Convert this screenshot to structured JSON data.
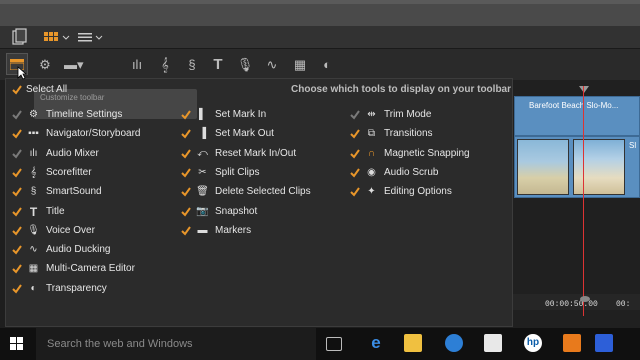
{
  "panel": {
    "select_all": "Select All",
    "header": "Choose which tools to display on your toolbar",
    "ghost_line1": "Customize toolbar",
    "col1": [
      {
        "label": "Timeline Settings",
        "icon": "gear-icon",
        "checked": "dim"
      },
      {
        "label": "Navigator/Storyboard",
        "icon": "navigator-icon",
        "checked": "on"
      },
      {
        "label": "Audio Mixer",
        "icon": "audio-mixer-icon",
        "checked": "dim"
      },
      {
        "label": "Scorefitter",
        "icon": "scorefitter-icon",
        "checked": "on"
      },
      {
        "label": "SmartSound",
        "icon": "smartsound-icon",
        "checked": "on"
      },
      {
        "label": "Title",
        "icon": "title-icon",
        "checked": "on"
      },
      {
        "label": "Voice Over",
        "icon": "microphone-icon",
        "checked": "on"
      },
      {
        "label": "Audio Ducking",
        "icon": "audio-ducking-icon",
        "checked": "on"
      },
      {
        "label": "Multi-Camera Editor",
        "icon": "multicam-icon",
        "checked": "on"
      },
      {
        "label": "Transparency",
        "icon": "transparency-icon",
        "checked": "on"
      }
    ],
    "col2": [
      {
        "label": "Set Mark In",
        "icon": "mark-in-icon",
        "checked": "on"
      },
      {
        "label": "Set Mark Out",
        "icon": "mark-out-icon",
        "checked": "on"
      },
      {
        "label": "Reset Mark In/Out",
        "icon": "reset-mark-icon",
        "checked": "on"
      },
      {
        "label": "Split Clips",
        "icon": "split-clip-icon",
        "checked": "on"
      },
      {
        "label": "Delete Selected Clips",
        "icon": "trash-icon",
        "checked": "on"
      },
      {
        "label": "Snapshot",
        "icon": "camera-icon",
        "checked": "on"
      },
      {
        "label": "Markers",
        "icon": "marker-icon",
        "checked": "on"
      }
    ],
    "col3": [
      {
        "label": "Trim Mode",
        "icon": "trim-icon",
        "checked": "dim"
      },
      {
        "label": "Transitions",
        "icon": "transitions-icon",
        "checked": "on"
      },
      {
        "label": "Magnetic Snapping",
        "icon": "magnet-icon",
        "checked": "on"
      },
      {
        "label": "Audio Scrub",
        "icon": "audio-scrub-icon",
        "checked": "on"
      },
      {
        "label": "Editing Options",
        "icon": "magic-wand-icon",
        "checked": "on"
      }
    ]
  },
  "timeline": {
    "clip_title": "Barefoot Beach Slo-Mo...",
    "clip2_label": "Sl",
    "time1": "00:00:50.00",
    "time2": "00:"
  },
  "taskbar": {
    "search_placeholder": "Search the web and Windows"
  },
  "colors": {
    "accent": "#e8962a",
    "clip": "#5a8fc0",
    "playhead": "#d33333"
  }
}
